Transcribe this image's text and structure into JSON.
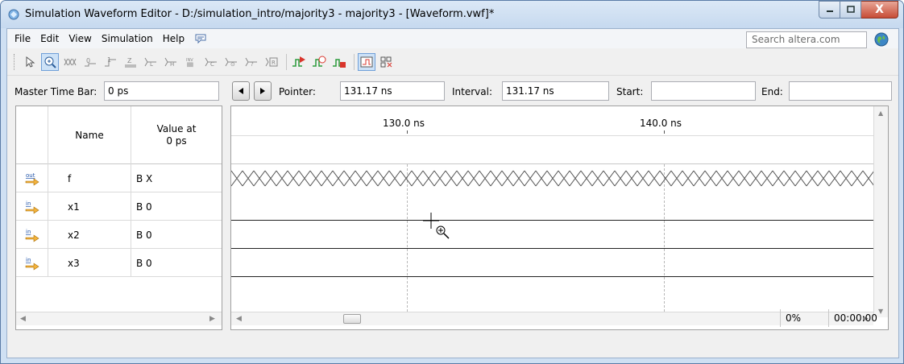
{
  "window": {
    "title": "Simulation Waveform Editor - D:/simulation_intro/majority3 - majority3 - [Waveform.vwf]*",
    "min_label": "—",
    "max_label": "☐",
    "close_label": "X"
  },
  "menu": {
    "items": [
      "File",
      "Edit",
      "View",
      "Simulation",
      "Help"
    ],
    "search_placeholder": "Search altera.com"
  },
  "toolbar": {
    "icons": [
      "pointer-icon",
      "zoom-icon",
      "uninitialized-icon",
      "force-low-icon",
      "force-high-icon",
      "high-impedance-icon",
      "weak-low-icon",
      "weak-high-icon",
      "invert-icon",
      "count-value-icon",
      "clock-icon",
      "arbitrary-value-icon",
      "random-value-icon",
      "run-functional-simulation-icon",
      "run-timing-simulation-icon",
      "generate-netlist-icon",
      "snap-to-grid-icon",
      "sort-icon"
    ]
  },
  "timebar": {
    "master_label": "Master Time Bar:",
    "master_value": "0 ps",
    "pointer_label": "Pointer:",
    "pointer_value": "131.17 ns",
    "interval_label": "Interval:",
    "interval_value": "131.17 ns",
    "start_label": "Start:",
    "start_value": "",
    "end_label": "End:",
    "end_value": ""
  },
  "signals": {
    "col_name": "Name",
    "col_value": "Value at\n0 ps",
    "rows": [
      {
        "dir": "out",
        "name": "f",
        "value": "B X"
      },
      {
        "dir": "in",
        "name": "x1",
        "value": "B 0"
      },
      {
        "dir": "in",
        "name": "x2",
        "value": "B 0"
      },
      {
        "dir": "in",
        "name": "x3",
        "value": "B 0"
      }
    ]
  },
  "ruler": {
    "label_130": "130.0 ns",
    "label_140": "140.0 ns"
  },
  "status": {
    "progress": "0%",
    "elapsed": "00:00:00"
  },
  "colors": {
    "accent": "#6f9fd8",
    "wave": "#222222"
  }
}
